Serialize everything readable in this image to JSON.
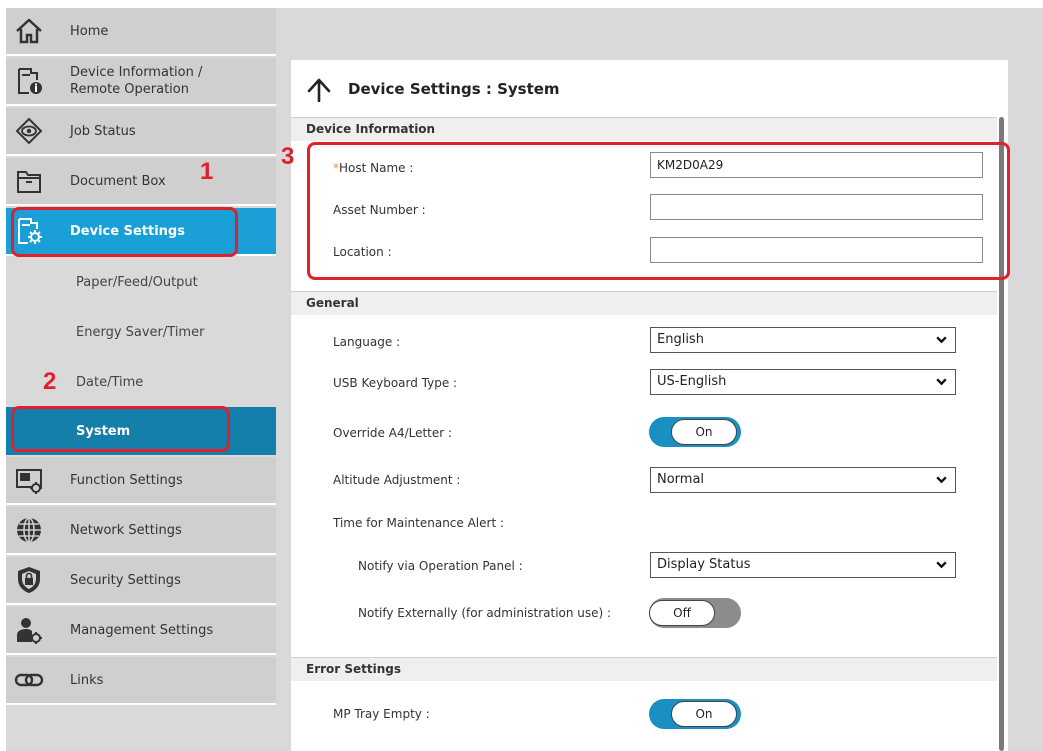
{
  "sidebar": {
    "items": [
      {
        "label": "Home",
        "icon": "home-icon"
      },
      {
        "label": "Device Information / Remote Operation",
        "line1": "Device Information /",
        "line2": "Remote Operation",
        "icon": "device-info-icon"
      },
      {
        "label": "Job Status",
        "icon": "job-status-icon"
      },
      {
        "label": "Document Box",
        "icon": "document-box-icon"
      },
      {
        "label": "Device Settings",
        "icon": "device-settings-icon",
        "active": true
      },
      {
        "label": "Function Settings",
        "icon": "function-settings-icon"
      },
      {
        "label": "Network Settings",
        "icon": "network-globe-icon"
      },
      {
        "label": "Security Settings",
        "icon": "security-shield-icon"
      },
      {
        "label": "Management Settings",
        "icon": "management-user-icon"
      },
      {
        "label": "Links",
        "icon": "link-icon"
      }
    ],
    "subitems": [
      {
        "label": "Paper/Feed/Output"
      },
      {
        "label": "Energy Saver/Timer"
      },
      {
        "label": "Date/Time"
      },
      {
        "label": "System",
        "active": true
      }
    ]
  },
  "page": {
    "title": "Device Settings : System",
    "back_icon": "up-arrow-icon"
  },
  "sections": {
    "device_info": {
      "title": "Device Information",
      "host_name_label": "Host Name :",
      "required_mark": "*",
      "host_name_value": "KM2D0A29",
      "asset_number_label": "Asset Number :",
      "asset_number_value": "",
      "location_label": "Location :",
      "location_value": ""
    },
    "general": {
      "title": "General",
      "language_label": "Language :",
      "language_value": "English",
      "usb_keyboard_label": "USB Keyboard Type :",
      "usb_keyboard_value": "US-English",
      "override_label": "Override A4/Letter :",
      "override_value": "On",
      "altitude_label": "Altitude Adjustment :",
      "altitude_value": "Normal",
      "maintenance_label": "Time for Maintenance Alert :",
      "notify_panel_label": "Notify via Operation Panel :",
      "notify_panel_value": "Display Status",
      "notify_external_label": "Notify Externally (for administration use) :",
      "notify_external_value": "Off"
    },
    "error": {
      "title": "Error Settings",
      "mp_tray_label": "MP Tray Empty :",
      "mp_tray_value": "On"
    }
  },
  "callouts": {
    "one": "1",
    "two": "2",
    "three": "3"
  },
  "colors": {
    "accent": "#1a9fd7",
    "accent_dark": "#157fab",
    "callout": "#e0202a",
    "toggle_on": "#1a8fc4"
  }
}
